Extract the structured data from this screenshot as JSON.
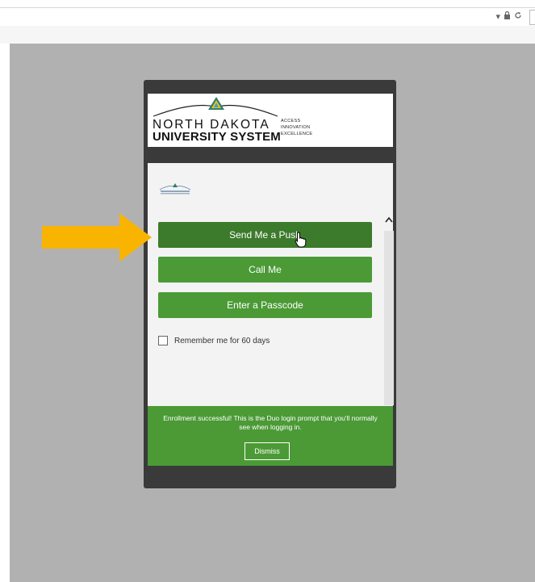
{
  "org": {
    "name_line1": "NORTH DAKOTA",
    "name_line2": "UNIVERSITY SYSTEM",
    "taglines": [
      "ACCESS",
      "INNOVATION",
      "EXCELLENCE"
    ]
  },
  "duo": {
    "buttons": {
      "push": "Send Me a Push",
      "call": "Call Me",
      "passcode": "Enter a Passcode"
    },
    "remember_label": "Remember me for 60 days",
    "banner": {
      "message": "Enrollment successful! This is the Duo login prompt that you'll normally see when logging in.",
      "dismiss_label": "Dismiss"
    }
  },
  "colors": {
    "duo_green": "#4b9a36",
    "duo_green_active": "#3c7a2c",
    "arrow": "#f8b400",
    "page_gray": "#b1b1b1",
    "frame": "#3a3a3a"
  },
  "icons": [
    "dropdown-arrow-icon",
    "lock-icon",
    "reload-icon",
    "ndus-logo-icon",
    "hand-cursor-icon",
    "scroll-up-icon",
    "orange-arrow-icon"
  ]
}
